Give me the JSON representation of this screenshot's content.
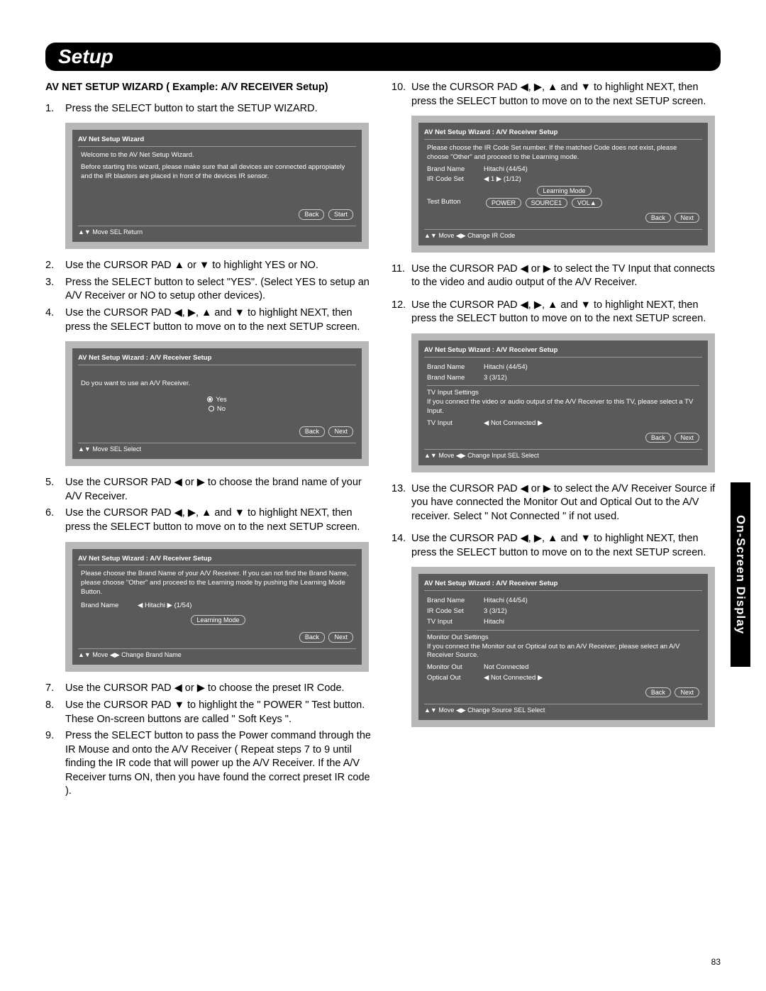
{
  "header": "Setup",
  "sideTab": "On-Screen Display",
  "pageNum": "83",
  "sectionTitle": "AV NET SETUP WIZARD ( Example: A/V RECEIVER Setup)",
  "arrows": {
    "l": "◀",
    "r": "▶",
    "u": "▲",
    "d": "▼",
    "updn": "▲ or ▼",
    "lr": "◀ or ▶",
    "all": "◀, ▶, ▲ and ▼"
  },
  "left": {
    "s1": "Press the SELECT button to start the SETUP WIZARD.",
    "s2": "Use the CURSOR PAD ▲ or ▼ to highlight YES or NO.",
    "s3": "Press the SELECT button to select \"YES\". (Select YES to setup an A/V Receiver or NO to setup other devices).",
    "s4": "Use the CURSOR PAD ◀, ▶, ▲ and ▼ to highlight NEXT, then press the SELECT button to move on to the next SETUP screen.",
    "s5": "Use the CURSOR PAD ◀ or ▶ to choose the brand name of your A/V Receiver.",
    "s6": "Use the CURSOR PAD ◀, ▶, ▲ and ▼ to highlight NEXT, then press the SELECT button to move on to the next SETUP screen.",
    "s7": "Use the CURSOR PAD ◀ or ▶ to choose the preset IR Code.",
    "s8": "Use the CURSOR PAD ▼ to highlight the \" POWER \" Test button.\nThese On-screen buttons are called \" Soft Keys \".",
    "s9": "Press the SELECT button to pass the Power command through the IR Mouse and onto the A/V Receiver ( Repeat steps 7 to 9 until finding the IR code that will power up the A/V Receiver. If the A/V Receiver turns ON, then you have found the correct preset IR code )."
  },
  "right": {
    "s10": "Use the CURSOR PAD ◀, ▶, ▲ and ▼ to highlight NEXT, then press the SELECT button to move on to the next SETUP screen.",
    "s11": "Use the CURSOR PAD ◀ or ▶ to select the TV Input that connects   to the video and audio output of the A/V Receiver.",
    "s12": "Use the CURSOR PAD ◀, ▶, ▲ and ▼ to highlight NEXT, then press the SELECT button to move on to the next SETUP screen.",
    "s13": "Use the CURSOR PAD ◀ or ▶ to select the A/V Receiver Source if you have connected the Monitor Out and Optical Out to the A/V receiver. Select \" Not Connected \" if not used.",
    "s14": "Use the CURSOR PAD ◀, ▶, ▲ and ▼ to highlight NEXT, then press the SELECT button to move on to the next SETUP screen."
  },
  "osd1": {
    "title": "AV Net Setup Wizard",
    "l1": "Welcome to the AV Net Setup Wizard.",
    "l2": "Before starting this wizard, please make sure that all devices are connected appropiately and the IR blasters are placed in front of the devices IR sensor.",
    "b1": "Back",
    "b2": "Start",
    "foot": "▲▼ Move   SEL Return"
  },
  "osd2": {
    "title": "AV Net Setup Wizard : A/V Receiver Setup",
    "l1": "Do you want to use an A/V Receiver.",
    "yes": "Yes",
    "no": "No",
    "b1": "Back",
    "b2": "Next",
    "foot": "▲▼ Move   SEL Select"
  },
  "osd3": {
    "title": "AV Net Setup Wizard : A/V Receiver Setup",
    "l1": "Please choose the Brand Name of your A/V Receiver. If you can not find the Brand Name, please choose \"Other\" and proceed to the Learning mode by pushing the Learning Mode Button.",
    "brand_lbl": "Brand Name",
    "brand_val": "◀  Hitachi  ▶   (1/54)",
    "lm": "Learning Mode",
    "b1": "Back",
    "b2": "Next",
    "foot": "▲▼ Move   ◀▶ Change Brand Name"
  },
  "osd4": {
    "title": "AV Net Setup Wizard : A/V Receiver Setup",
    "l1": "Please choose the IR Code Set number. If the matched Code does not exist, please choose \"Other\" and proceed to the Learning mode.",
    "brand_lbl": "Brand Name",
    "brand_val": "Hitachi        (44/54)",
    "ir_lbl": "IR Code Set",
    "ir_val": "◀   1   ▶   (1/12)",
    "lm": "Learning Mode",
    "test_lbl": "Test Button",
    "t1": "POWER",
    "t2": "SOURCE1",
    "t3": "VOL▲",
    "b1": "Back",
    "b2": "Next",
    "foot": "▲▼ Move   ◀▶ Change IR Code"
  },
  "osd5": {
    "title": "AV Net Setup Wizard : A/V Receiver Setup",
    "brand_lbl": "Brand Name",
    "brand_val": "Hitachi        (44/54)",
    "brand_lbl2": "Brand Name",
    "brand_val2": "3        (3/12)",
    "sec": "TV Input Settings",
    "l1": "If you connect the video or audio output of the A/V Receiver to this TV, please select a TV Input.",
    "tv_lbl": "TV Input",
    "tv_val": "◀  Not Connected  ▶",
    "b1": "Back",
    "b2": "Next",
    "foot": "▲▼ Move   ◀▶ Change Input        SEL Select"
  },
  "osd6": {
    "title": "AV Net Setup Wizard : A/V Receiver Setup",
    "brand_lbl": "Brand Name",
    "brand_val": "Hitachi        (44/54)",
    "ir_lbl": "IR Code Set",
    "ir_val": "3        (3/12)",
    "tv_lbl": "TV Input",
    "tv_val": "Hitachi",
    "sec": "Monitor Out Settings",
    "l1": "If you connect the Monitor out or Optical out to an A/V Receiver, please select an A/V Receiver Source.",
    "mon_lbl": "Monitor Out",
    "mon_val": "Not Connected",
    "opt_lbl": "Optical Out",
    "opt_val": "◀  Not Connected  ▶",
    "b1": "Back",
    "b2": "Next",
    "foot": "▲▼ Move   ◀▶ Change Source       SEL Select"
  }
}
